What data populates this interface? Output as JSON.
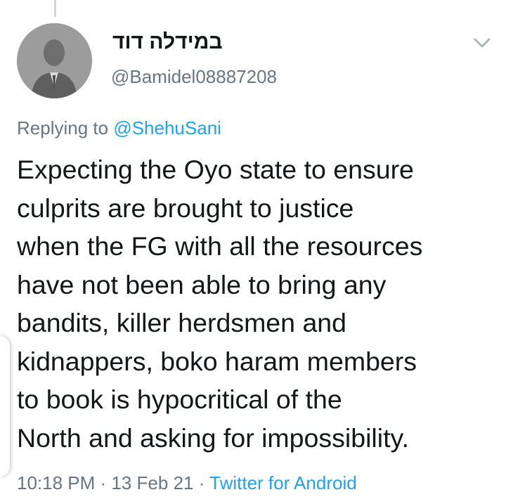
{
  "tweet": {
    "display_name": "במידלה דוד",
    "handle": "@Bamidel08887208",
    "reply_prefix": "Replying to",
    "reply_to": "@ShehuSani",
    "text": "Expecting the Oyo state to ensure\nculprits are brought to justice\nwhen the FG with all the resources\nhave not been able to bring any\nbandits, killer herdsmen and\nkidnappers, boko haram members\nto book is hypocritical of the\nNorth and asking for impossibility.",
    "time": "10:18 PM",
    "separator": " · ",
    "date": "13 Feb 21",
    "source": "Twitter for Android"
  },
  "icons": {
    "menu": "chevron-down-icon",
    "avatar": "default-avatar-silhouette"
  },
  "colors": {
    "text_primary": "#14171a",
    "text_secondary": "#657786",
    "link": "#1da1f2",
    "thread_line": "#ccd6dd"
  }
}
